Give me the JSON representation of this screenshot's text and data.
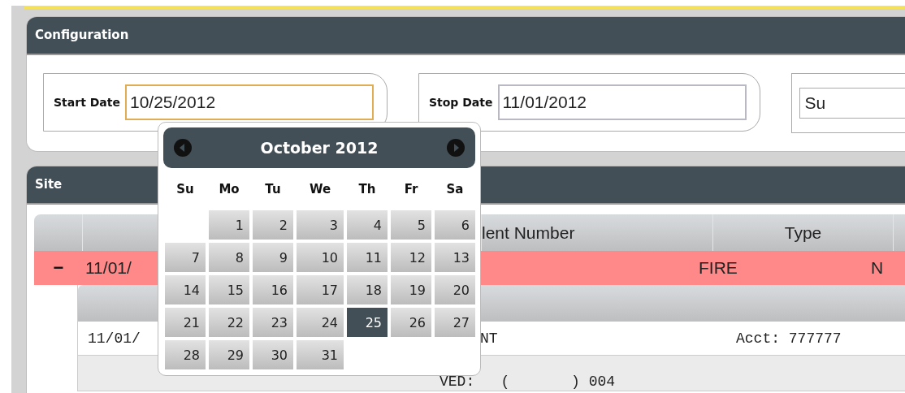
{
  "configuration": {
    "title": "Configuration",
    "fields": [
      {
        "label": "Start Date",
        "value": "10/25/2012",
        "focused": true
      },
      {
        "label": "Stop Date",
        "value": "11/01/2012",
        "focused": false
      }
    ],
    "field_3": {
      "value": "Su"
    }
  },
  "site": {
    "title": "Site",
    "table": {
      "columns": [
        {
          "label": "lent Number"
        },
        {
          "label": "Type"
        }
      ],
      "rows": [
        {
          "toggle": "−",
          "expanded": true,
          "cells": [
            "11/01/",
            "FIRE",
            "N"
          ],
          "detail": [
            {
              "cells": [
                "11/01/",
                "NT",
                "Acct: 777777"
              ]
            },
            {
              "cells": [
                "VED:   (       ) 004"
              ]
            }
          ]
        }
      ]
    }
  },
  "calendar": {
    "title": "October 2012",
    "weekdays": [
      "Su",
      "Mo",
      "Tu",
      "We",
      "Th",
      "Fr",
      "Sa"
    ],
    "weeks": [
      [
        {
          "label": "1",
          "selected": false
        },
        {
          "label": "2",
          "selected": false
        },
        {
          "label": "3",
          "selected": false
        },
        {
          "label": "4",
          "selected": false
        },
        {
          "label": "5",
          "selected": false
        },
        {
          "label": "6",
          "selected": false
        }
      ],
      [
        {
          "label": "7",
          "selected": false
        },
        {
          "label": "8",
          "selected": false
        },
        {
          "label": "9",
          "selected": false
        },
        {
          "label": "10",
          "selected": false
        },
        {
          "label": "11",
          "selected": false
        },
        {
          "label": "12",
          "selected": false
        },
        {
          "label": "13",
          "selected": false
        }
      ],
      [
        {
          "label": "14",
          "selected": false
        },
        {
          "label": "15",
          "selected": false
        },
        {
          "label": "16",
          "selected": false
        },
        {
          "label": "17",
          "selected": false
        },
        {
          "label": "18",
          "selected": false
        },
        {
          "label": "19",
          "selected": false
        },
        {
          "label": "20",
          "selected": false
        }
      ],
      [
        {
          "label": "21",
          "selected": false
        },
        {
          "label": "22",
          "selected": false
        },
        {
          "label": "23",
          "selected": false
        },
        {
          "label": "24",
          "selected": false
        },
        {
          "label": "25",
          "selected": true
        },
        {
          "label": "26",
          "selected": false
        },
        {
          "label": "27",
          "selected": false
        }
      ],
      [
        {
          "label": "28",
          "selected": false
        },
        {
          "label": "29",
          "selected": false
        },
        {
          "label": "30",
          "selected": false
        },
        {
          "label": "31",
          "selected": false
        }
      ]
    ]
  }
}
